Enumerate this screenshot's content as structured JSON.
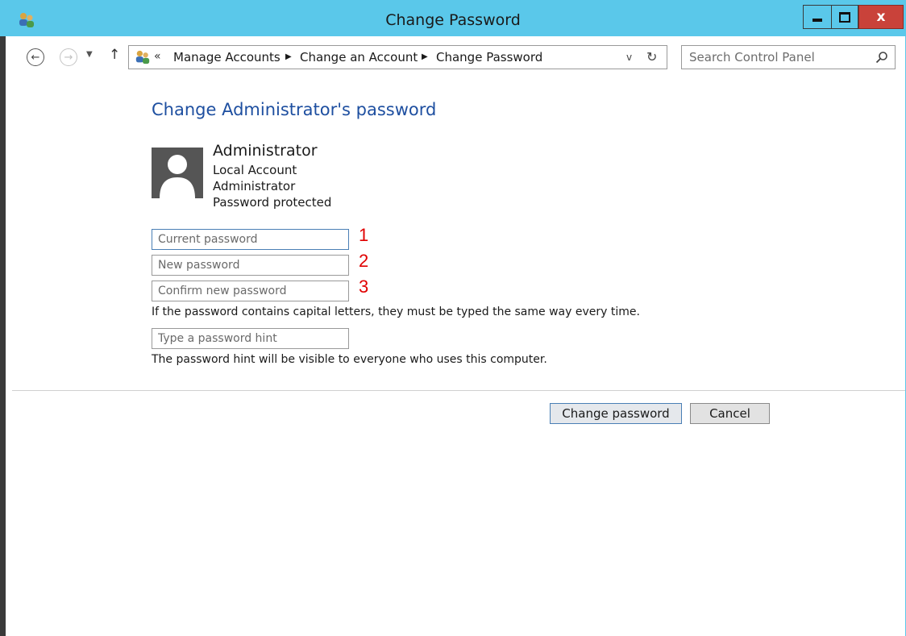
{
  "window": {
    "title": "Change Password",
    "icon": "users-icon",
    "controls": [
      "minimize",
      "maximize",
      "close"
    ],
    "close_label": "x"
  },
  "nav": {
    "back_icon": "back-arrow-icon",
    "forward_icon": "forward-arrow-icon",
    "up_icon": "up-arrow-icon",
    "recent_icon": "chevron-down-icon"
  },
  "address": {
    "prefix": "«",
    "crumbs": [
      "Manage Accounts",
      "Change an Account",
      "Change Password"
    ],
    "dropdown_glyph": "v",
    "refresh_glyph": "↻"
  },
  "search": {
    "placeholder": "Search Control Panel"
  },
  "page": {
    "heading": "Change Administrator's password",
    "user": {
      "name": "Administrator",
      "details": [
        "Local Account",
        "Administrator",
        "Password protected"
      ]
    },
    "fields": {
      "current": "Current password",
      "new": "New password",
      "confirm": "Confirm new password",
      "hint": "Type a password hint"
    },
    "markers": [
      "1",
      "2",
      "3"
    ],
    "case_note": "If the password contains capital letters, they must be typed the same way every time.",
    "hint_note": "The password hint will be visible to everyone who uses this computer."
  },
  "buttons": {
    "change": "Change password",
    "cancel": "Cancel"
  },
  "colors": {
    "titlebar": "#5ac8ea",
    "heading": "#1e4fa0",
    "close": "#c9423a",
    "marker": "#e00000"
  }
}
